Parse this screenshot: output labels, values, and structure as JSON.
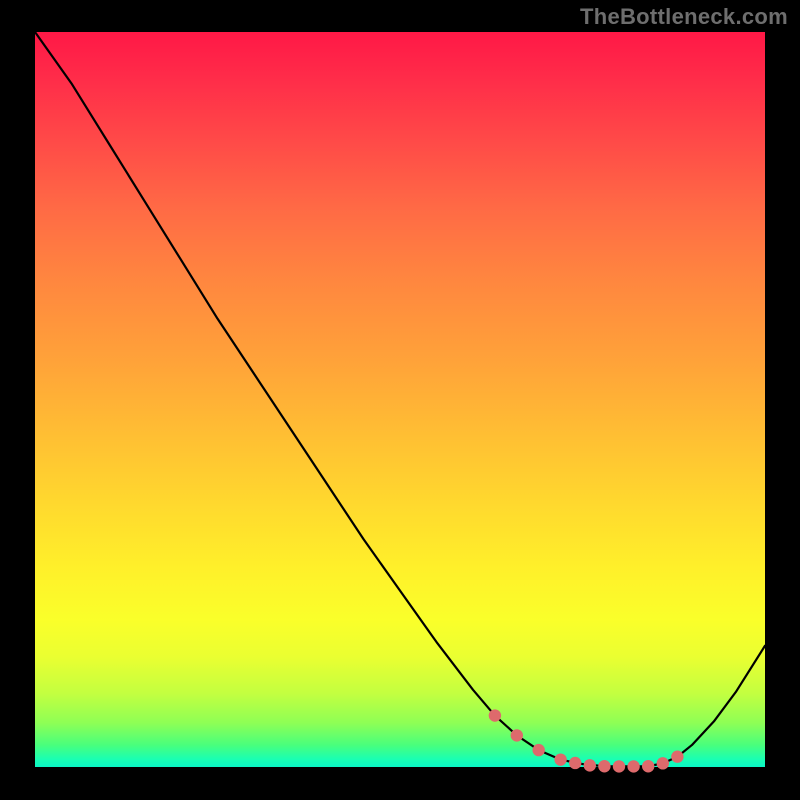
{
  "watermark": "TheBottleneck.com",
  "colors": {
    "curve_stroke": "#000000",
    "marker_fill": "#de6a6c",
    "marker_stroke": "#de6a6c"
  },
  "chart_data": {
    "type": "line",
    "title": "",
    "xlabel": "",
    "ylabel": "",
    "xlim": [
      0,
      100
    ],
    "ylim": [
      0,
      100
    ],
    "x": [
      0,
      5,
      10,
      15,
      20,
      25,
      30,
      35,
      40,
      45,
      50,
      55,
      60,
      63,
      66,
      69,
      72,
      75,
      78,
      80,
      82,
      84,
      86,
      88,
      90,
      93,
      96,
      100
    ],
    "values": [
      100,
      93,
      85,
      77,
      69,
      61,
      53.5,
      46,
      38.5,
      31,
      24,
      17,
      10.5,
      7,
      4.3,
      2.3,
      1.0,
      0.4,
      0.1,
      0.08,
      0.08,
      0.1,
      0.5,
      1.4,
      3.0,
      6.2,
      10.2,
      16.5
    ],
    "markers": {
      "x": [
        63,
        66,
        69,
        72,
        74,
        76,
        78,
        80,
        82,
        84,
        86,
        88
      ],
      "values": [
        7.0,
        4.3,
        2.3,
        1.0,
        0.55,
        0.22,
        0.1,
        0.08,
        0.08,
        0.1,
        0.5,
        1.4
      ]
    }
  }
}
